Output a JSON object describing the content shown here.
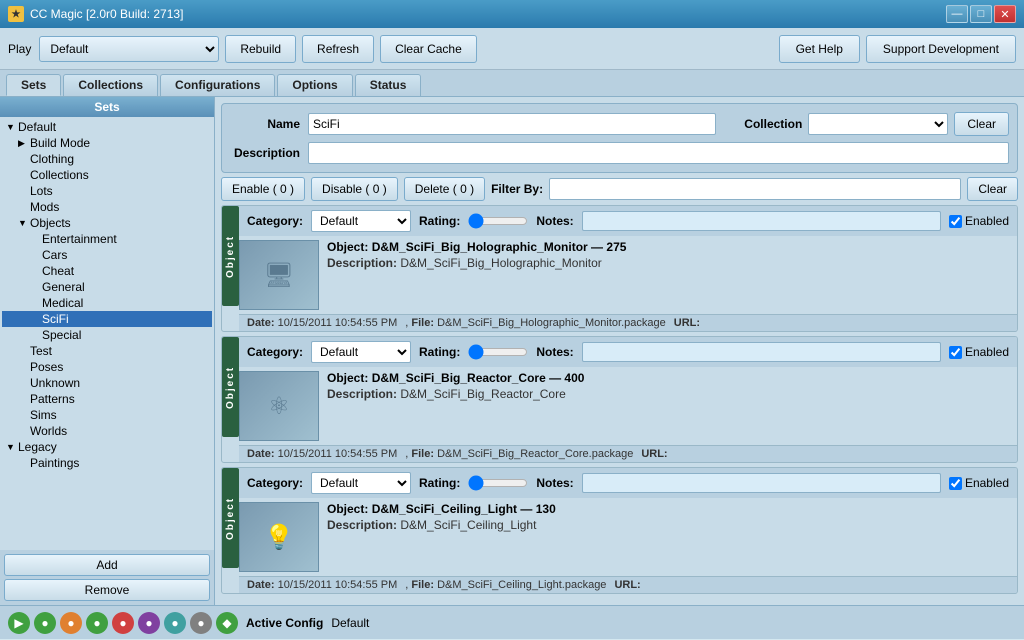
{
  "titleBar": {
    "title": "CC Magic [2.0r0 Build: 2713]",
    "icon": "★",
    "controls": [
      "—",
      "□",
      "✕"
    ]
  },
  "toolbar": {
    "playLabel": "Play",
    "defaultOption": "Default",
    "playOptions": [
      "Default"
    ],
    "rebuildLabel": "Rebuild",
    "refreshLabel": "Refresh",
    "clearCacheLabel": "Clear Cache",
    "getHelpLabel": "Get Help",
    "supportLabel": "Support Development"
  },
  "tabs": [
    {
      "id": "sets",
      "label": "Sets",
      "active": true
    },
    {
      "id": "collections",
      "label": "Collections",
      "active": false
    },
    {
      "id": "configurations",
      "label": "Configurations",
      "active": false
    },
    {
      "id": "options",
      "label": "Options",
      "active": false
    },
    {
      "id": "status",
      "label": "Status",
      "active": false
    }
  ],
  "sidebar": {
    "header": "Sets",
    "tree": [
      {
        "id": "default",
        "label": "◄ Default",
        "level": 0,
        "expanded": true
      },
      {
        "id": "build-mode",
        "label": "▶ Build Mode",
        "level": 1
      },
      {
        "id": "clothing",
        "label": "Clothing",
        "level": 1
      },
      {
        "id": "collections",
        "label": "Collections",
        "level": 1
      },
      {
        "id": "lots",
        "label": "Lots",
        "level": 1
      },
      {
        "id": "mods",
        "label": "Mods",
        "level": 1
      },
      {
        "id": "objects",
        "label": "◄ Objects",
        "level": 1,
        "expanded": true
      },
      {
        "id": "entertainment",
        "label": "Entertainment",
        "level": 2
      },
      {
        "id": "cars",
        "label": "Cars",
        "level": 2
      },
      {
        "id": "cheat",
        "label": "Cheat",
        "level": 2
      },
      {
        "id": "general",
        "label": "General",
        "level": 2
      },
      {
        "id": "medical",
        "label": "Medical",
        "level": 2
      },
      {
        "id": "scifi",
        "label": "SciFi",
        "level": 2,
        "selected": true
      },
      {
        "id": "special",
        "label": "Special",
        "level": 2
      },
      {
        "id": "test",
        "label": "Test",
        "level": 1
      },
      {
        "id": "poses",
        "label": "Poses",
        "level": 1
      },
      {
        "id": "unknown",
        "label": "Unknown",
        "level": 1
      },
      {
        "id": "patterns",
        "label": "Patterns",
        "level": 1
      },
      {
        "id": "sims",
        "label": "Sims",
        "level": 1
      },
      {
        "id": "worlds",
        "label": "Worlds",
        "level": 1
      },
      {
        "id": "legacy",
        "label": "◄ Legacy",
        "level": 0,
        "expanded": true
      },
      {
        "id": "paintings",
        "label": "Paintings",
        "level": 1
      }
    ],
    "addLabel": "Add",
    "removeLabel": "Remove"
  },
  "detailPanel": {
    "nameLabel": "Name",
    "nameValue": "SciFi",
    "descriptionLabel": "Description",
    "descriptionValue": "",
    "collectionLabel": "Collection",
    "collectionValue": "",
    "clearLabel": "Clear"
  },
  "filterBar": {
    "enableLabel": "Enable ( 0 )",
    "disableLabel": "Disable ( 0 )",
    "deleteLabel": "Delete ( 0 )",
    "filterByLabel": "Filter By:",
    "filterValue": "",
    "clearLabel": "Clear"
  },
  "objects": [
    {
      "tag": "Object",
      "category": "Default",
      "rating": "",
      "notes": "",
      "enabled": true,
      "name": "D&M_SciFi_Big_Holographic_Monitor",
      "count": "275",
      "description": "D&M_SciFi_Big_Holographic_Monitor",
      "date": "10/15/2011 10:54:55 PM",
      "file": "D&M_SciFi_Big_Holographic_Monitor.package",
      "url": "",
      "thumbType": "monitor"
    },
    {
      "tag": "Object",
      "category": "Default",
      "rating": "",
      "notes": "",
      "enabled": true,
      "name": "D&M_SciFi_Big_Reactor_Core",
      "count": "400",
      "description": "D&M_SciFi_Big_Reactor_Core",
      "date": "10/15/2011 10:54:55 PM",
      "file": "D&M_SciFi_Big_Reactor_Core.package",
      "url": "",
      "thumbType": "reactor"
    },
    {
      "tag": "Object",
      "category": "Default",
      "rating": "",
      "notes": "",
      "enabled": true,
      "name": "D&M_SciFi_Ceiling_Light",
      "count": "130",
      "description": "D&M_SciFi_Ceiling_Light",
      "date": "10/15/2011 10:54:55 PM",
      "file": "D&M_SciFi_Ceiling_Light.package",
      "url": "",
      "thumbType": "light"
    }
  ],
  "statusBar": {
    "activeConfigLabel": "Active Config",
    "activeConfigValue": "Default",
    "icons": [
      {
        "id": "icon1",
        "color": "green",
        "symbol": "▶"
      },
      {
        "id": "icon2",
        "color": "green",
        "symbol": "●"
      },
      {
        "id": "icon3",
        "color": "orange",
        "symbol": "●"
      },
      {
        "id": "icon4",
        "color": "green",
        "symbol": "●"
      },
      {
        "id": "icon5",
        "color": "red",
        "symbol": "●"
      },
      {
        "id": "icon6",
        "color": "purple",
        "symbol": "●"
      },
      {
        "id": "icon7",
        "color": "teal",
        "symbol": "●"
      },
      {
        "id": "icon8",
        "color": "gray",
        "symbol": "●"
      },
      {
        "id": "icon9",
        "color": "green",
        "symbol": "◆"
      }
    ]
  }
}
